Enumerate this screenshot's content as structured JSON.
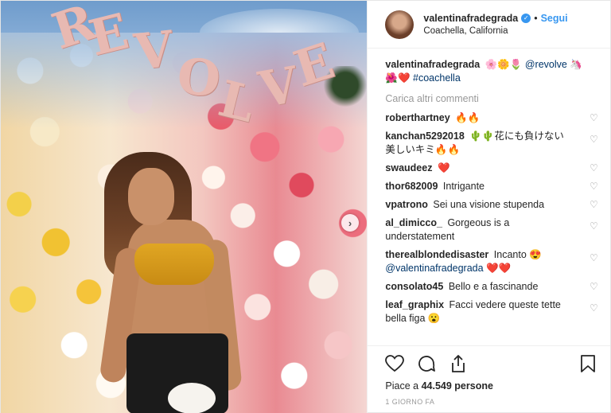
{
  "photo": {
    "sign_letters": [
      "R",
      "E",
      "V",
      "O",
      "L",
      "V",
      "E"
    ],
    "next_symbol": "›"
  },
  "header": {
    "username": "valentinafradegrada",
    "separator": "•",
    "follow_label": "Segui",
    "location": "Coachella, California"
  },
  "caption": {
    "username": "valentinafradegrada",
    "emojis_1": "🌸🌼🌷",
    "mention": "@revolve",
    "emojis_2": "🦄",
    "emojis_3": "🌺❤️",
    "hashtag": "#coachella"
  },
  "load_more": "Carica altri commenti",
  "comments": [
    {
      "user": "roberthartney",
      "text": "🔥🔥"
    },
    {
      "user": "kanchan5292018",
      "text": "🌵🌵花にも負けない美しいキミ🔥🔥"
    },
    {
      "user": "swaudeez",
      "text": "❤️"
    },
    {
      "user": "thor682009",
      "text": "Intrigante"
    },
    {
      "user": "vpatrono",
      "text": "Sei una visione stupenda"
    },
    {
      "user": "al_dimicco_",
      "text": "Gorgeous is a understatement"
    },
    {
      "user": "therealblondedisaster",
      "text": "Incanto 😍",
      "mention": "@valentinafradegrada",
      "after": "❤️❤️"
    },
    {
      "user": "consolato45",
      "text": "Bello e a fascinande"
    },
    {
      "user": "leaf_graphix",
      "text": "Facci vedere queste tette bella figa 😮"
    }
  ],
  "likes": {
    "prefix": "Piace a",
    "count": "44.549",
    "suffix": "persone"
  },
  "date": "1 GIORNO FA",
  "icons": {
    "like": "heart-icon",
    "comment": "comment-icon",
    "share": "share-icon",
    "save": "bookmark-icon"
  }
}
